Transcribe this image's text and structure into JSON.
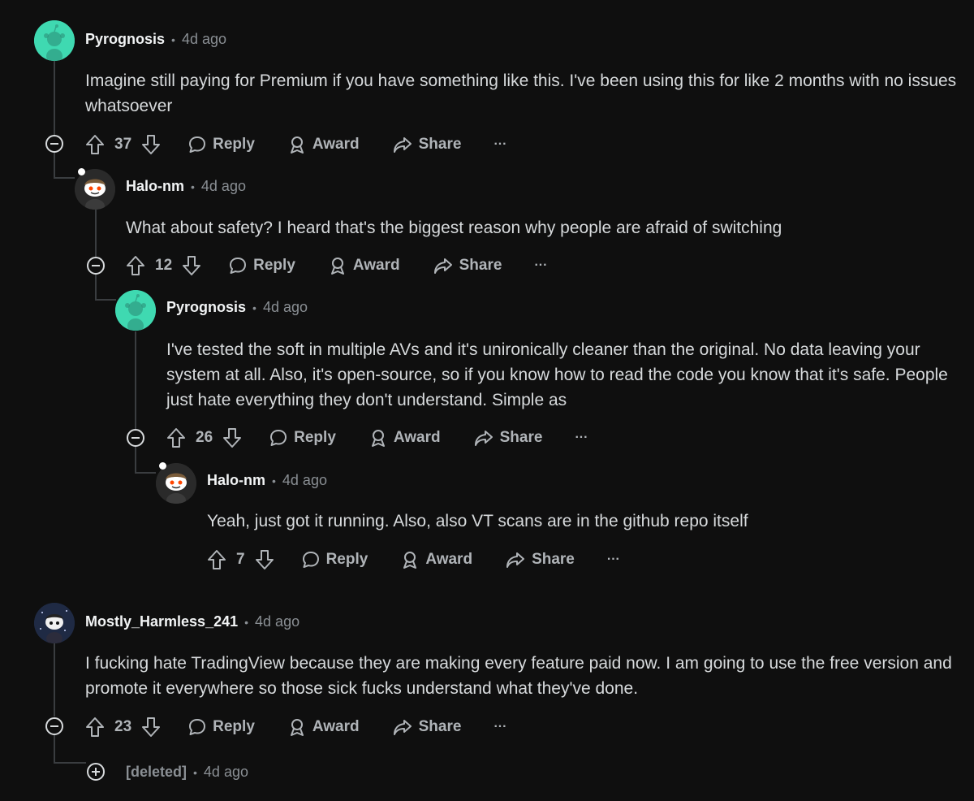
{
  "comments": [
    {
      "author": "Pyrognosis",
      "time": "4d ago",
      "body": "Imagine still paying for Premium if you have something like this. I've been using this for like 2 months with no issues whatsoever",
      "score": "37",
      "avatar_color": "#3fd9b1"
    },
    {
      "author": "Halo-nm",
      "time": "4d ago",
      "body": "What about safety? I heard that's the biggest reason why people are afraid of switching",
      "score": "12"
    },
    {
      "author": "Pyrognosis",
      "time": "4d ago",
      "body": "I've tested the soft in multiple AVs and it's unironically cleaner than the original. No data leaving your system at all. Also, it's open-source, so if you know how to read the code you know that it's safe. People just hate everything they don't understand. Simple as",
      "score": "26",
      "avatar_color": "#3fd9b1"
    },
    {
      "author": "Halo-nm",
      "time": "4d ago",
      "body": "Yeah, just got it running. Also, also VT scans are in the github repo itself",
      "score": "7"
    },
    {
      "author": "Mostly_Harmless_241",
      "time": "4d ago",
      "body": "I fucking hate TradingView because they are making every feature paid now. I am going to use the free version and promote it everywhere so those sick fucks understand what they've done.",
      "score": "23"
    },
    {
      "author": "[deleted]",
      "time": "4d ago"
    }
  ],
  "labels": {
    "reply": "Reply",
    "award": "Award",
    "share": "Share",
    "more": "···",
    "dot": "•"
  },
  "icons": [
    "upvote-icon",
    "downvote-icon",
    "reply-bubble-icon",
    "award-icon",
    "share-icon",
    "more-icon",
    "collapse-icon",
    "expand-icon"
  ]
}
